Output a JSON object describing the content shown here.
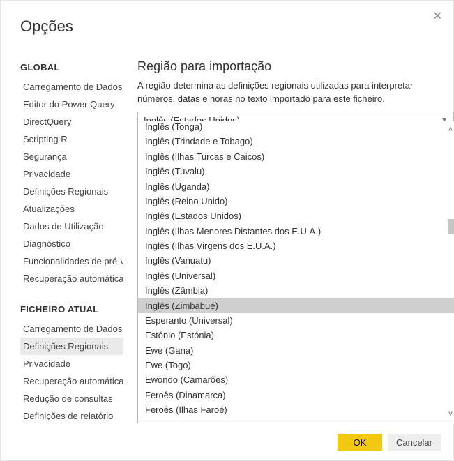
{
  "window": {
    "title": "Opções",
    "close_icon": "✕"
  },
  "sidebar": {
    "global_header": "GLOBAL",
    "global_items": [
      "Carregamento de Dados",
      "Editor do Power Query",
      "DirectQuery",
      "Scripting R",
      "Segurança",
      "Privacidade",
      "Definições Regionais",
      "Atualizações",
      "Dados de Utilização",
      "Diagnóstico",
      "Funcionalidades de pré-visualização",
      "Recuperação automática"
    ],
    "file_header": "FICHEIRO ATUAL",
    "file_items": [
      "Carregamento de Dados",
      "Definições Regionais",
      "Privacidade",
      "Recuperação automática",
      "Redução de consultas",
      "Definições de relatório"
    ],
    "file_selected_index": 1
  },
  "main": {
    "title": "Região para importação",
    "description": "A região determina as definições regionais utilizadas para interpretar números, datas e horas no texto importado para este ficheiro.",
    "combo_selected": "Inglês (Estados Unidos)"
  },
  "dropdown": {
    "partial_top": "Inglês (Tonga)",
    "items": [
      "Inglês (Trindade e Tobago)",
      "Inglês (Ilhas Turcas e Caicos)",
      "Inglês (Tuvalu)",
      "Inglês (Uganda)",
      "Inglês (Reino Unido)",
      "Inglês (Estados Unidos)",
      "Inglês (Ilhas Menores Distantes dos E.U.A.)",
      "Inglês (Ilhas Virgens dos E.U.A.)",
      "Inglês (Vanuatu)",
      "Inglês (Universal)",
      "Inglês (Zâmbia)",
      "Inglês (Zimbabué)",
      "Esperanto (Universal)",
      "Estónio (Estónia)",
      "Ewe (Gana)",
      "Ewe (Togo)",
      "Ewondo (Camarões)",
      "Feroês (Dinamarca)",
      "Feroês (Ilhas Faroé)"
    ],
    "highlighted_index": 11
  },
  "buttons": {
    "ok": "OK",
    "cancel": "Cancelar"
  }
}
